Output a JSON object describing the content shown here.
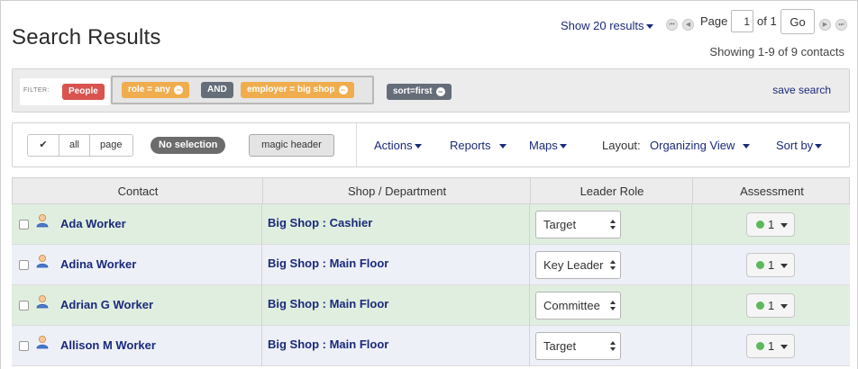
{
  "page": {
    "title": "Search Results"
  },
  "pagination": {
    "show_per_page": "Show 20 results",
    "page_label": "Page",
    "page_value": "1",
    "of_label": "of 1",
    "go_label": "Go",
    "showing_text": "Showing 1-9 of 9 contacts",
    "icons": [
      "first-page-icon",
      "previous-page-icon",
      "next-page-icon",
      "last-page-icon"
    ]
  },
  "filter": {
    "label": "FILTER:",
    "people_tag": "People",
    "role_tag": "role = any",
    "and_label": "AND",
    "employer_tag": "employer = big shop",
    "sort_tag": "sort=first",
    "save_search": "save search",
    "colors": {
      "people": "#d9534f",
      "criteria": "#f0ad4e",
      "neutral": "#656d78"
    }
  },
  "toolbar": {
    "check_icon": "✔",
    "all_label": "all",
    "page_label": "page",
    "no_selection": "No selection",
    "magic_header": "magic header",
    "actions": "Actions",
    "reports": "Reports",
    "maps": "Maps",
    "layout_label": "Layout:",
    "layout_value": "Organizing View",
    "sort_by": "Sort by"
  },
  "table": {
    "columns": [
      "Contact",
      "Shop / Department",
      "Leader Role",
      "Assessment"
    ],
    "rows": [
      {
        "name": "Ada Worker",
        "shop": "Big Shop : Cashier",
        "role": "Target",
        "assessment": "1"
      },
      {
        "name": "Adina Worker",
        "shop": "Big Shop : Main Floor",
        "role": "Key Leader",
        "assessment": "1"
      },
      {
        "name": "Adrian G Worker",
        "shop": "Big Shop : Main Floor",
        "role": "Committee",
        "assessment": "1"
      },
      {
        "name": "Allison M Worker",
        "shop": "Big Shop : Main Floor",
        "role": "Target",
        "assessment": "1"
      }
    ],
    "row_colors": {
      "green": "#e0eedf",
      "blue": "#eef0f8"
    },
    "assessment_dot_color": "#5cb85c"
  }
}
